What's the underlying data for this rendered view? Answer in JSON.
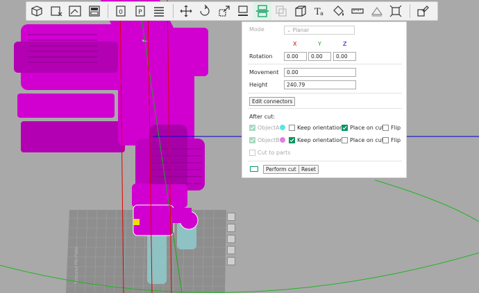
{
  "colors": {
    "background": "#a9a9a9",
    "model": "#d100d1",
    "model_dark": "#8a008a",
    "cut_object": "#8fc2c2",
    "x_axis": "#e00000",
    "y_axis": "#18a818",
    "z_axis": "#0000d0",
    "accent": "#00965f",
    "object_a_dot": "#57e6e6",
    "object_b_dot": "#e27ee2"
  },
  "toolbar": {
    "icons": [
      "add-cube-icon",
      "delete-icon",
      "arrange-icon",
      "split-plate-icon",
      "orient-icon",
      "fill-bed-icon",
      "plate-menu-icon",
      "move-icon",
      "rotate-icon",
      "scale-icon",
      "lay-on-face-icon",
      "cut-icon",
      "boolean-icon",
      "mesh-box-icon",
      "text-icon",
      "paint-icon",
      "measure-icon",
      "seam-icon",
      "assembly-icon",
      "variable-layer-icon"
    ]
  },
  "cut_panel": {
    "mode_label": "Mode",
    "mode_value": "Planar",
    "axis_x": "X",
    "axis_y": "Y",
    "axis_z": "Z",
    "rotation_label": "Rotation",
    "rotation_x": "0.00",
    "rotation_y": "0.00",
    "rotation_z": "0.00",
    "movement_label": "Movement",
    "movement_value": "0.00",
    "height_label": "Height",
    "height_value": "240.79",
    "edit_connectors": "Edit connectors",
    "after_cut_label": "After cut:",
    "object_a_label": "ObjectA",
    "object_b_label": "ObjectB",
    "keep_orientation_a": "Keep orientation",
    "keep_orientation_b": "Keep orientation",
    "place_on_cut_a": "Place on cut",
    "place_on_cut_b": "Place on cut",
    "flip_a": "Flip",
    "flip_b": "Flip",
    "cut_to_parts": "Cut to parts",
    "perform_cut": "Perform cut",
    "reset": "Reset"
  },
  "plate": {
    "label": "Textured PEI Plate"
  }
}
